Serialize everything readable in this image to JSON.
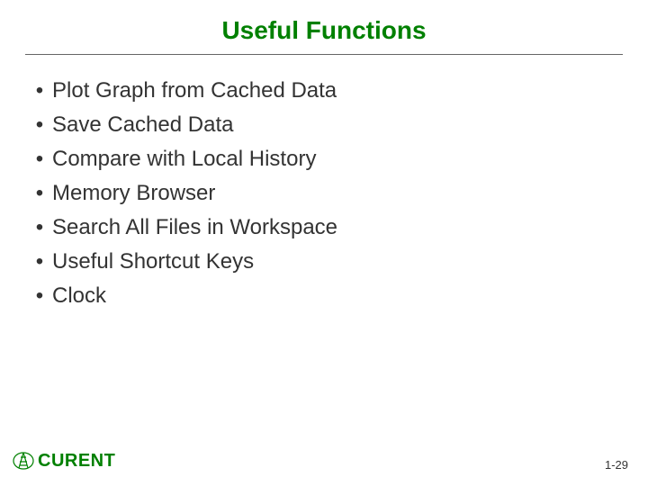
{
  "title": "Useful Functions",
  "bullets": [
    "Plot Graph from Cached Data",
    "Save Cached Data",
    "Compare with Local History",
    "Memory Browser",
    "Search All Files in Workspace",
    "Useful Shortcut Keys",
    "Clock"
  ],
  "logo_text": "CURENT",
  "page_number": "1-29"
}
